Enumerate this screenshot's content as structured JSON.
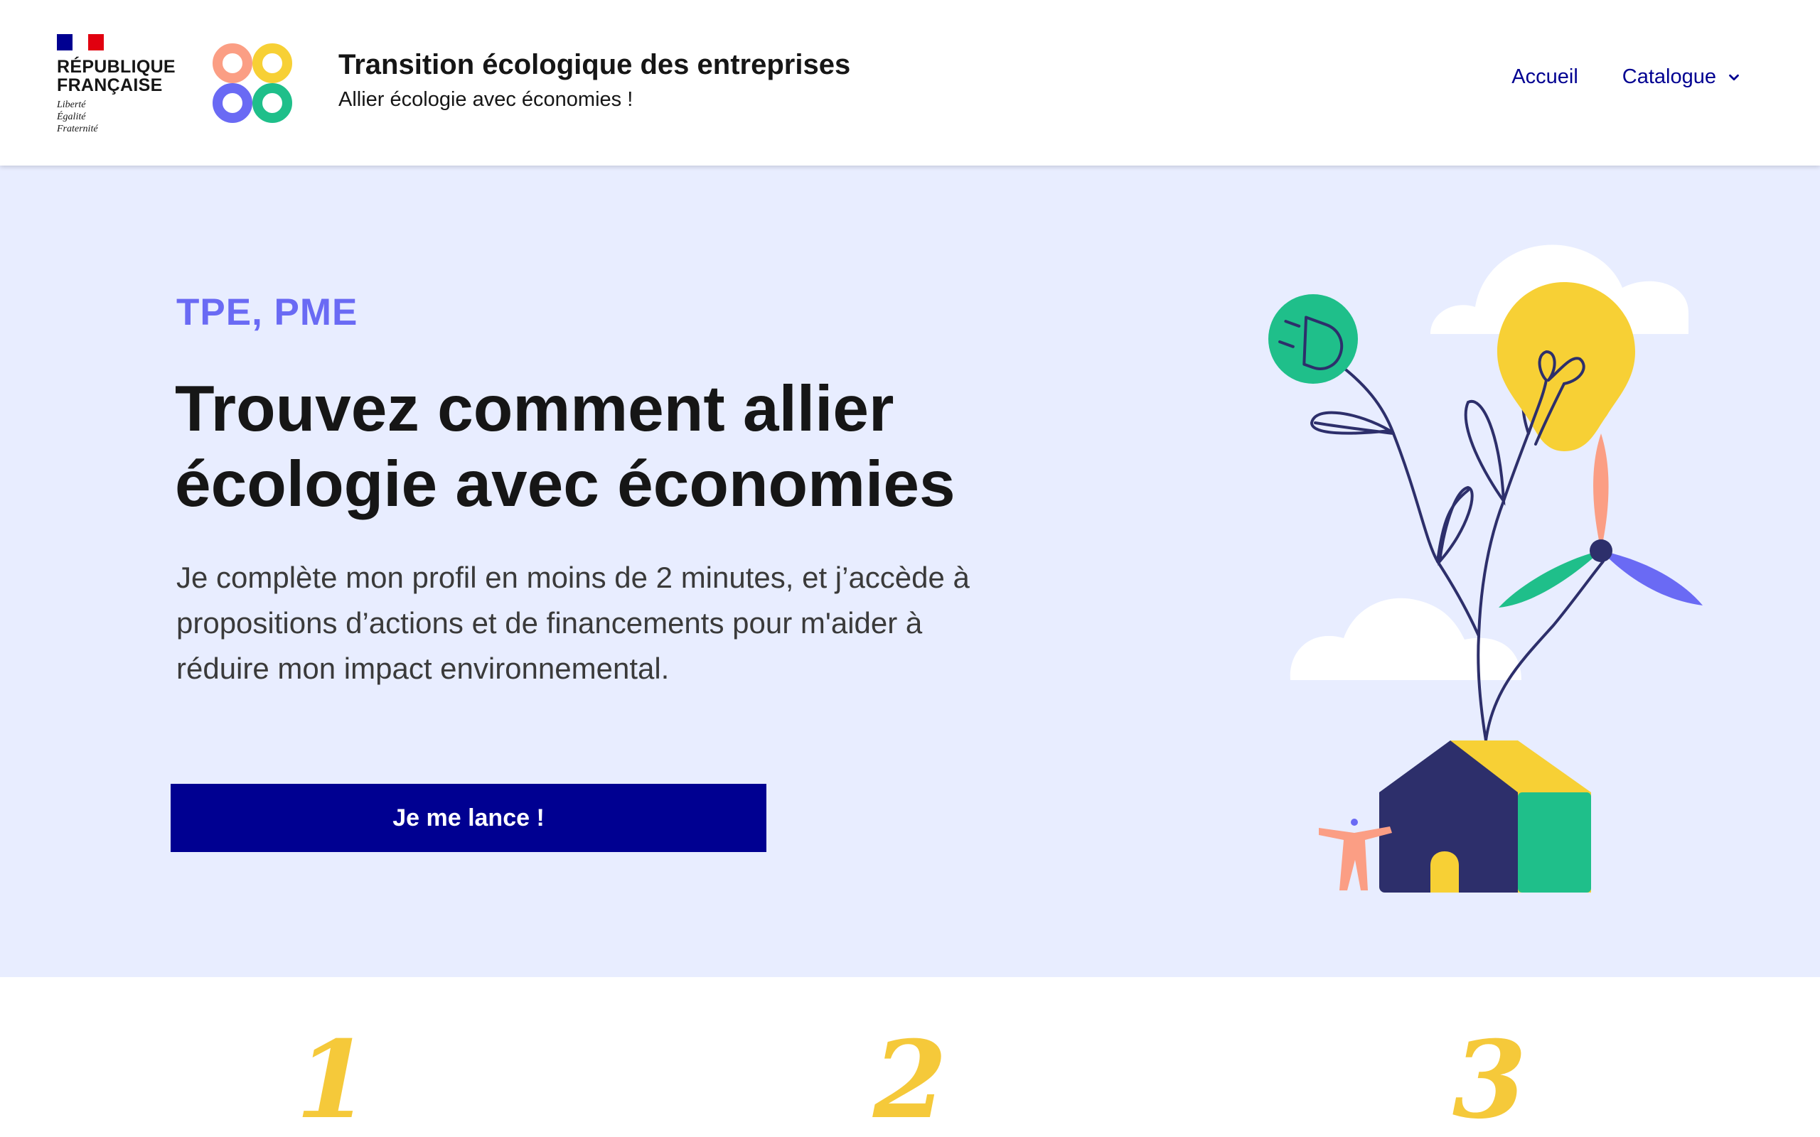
{
  "header": {
    "republic_name_line1": "RÉPUBLIQUE",
    "republic_name_line2": "FRANÇAISE",
    "motto_1": "Liberté",
    "motto_2": "Égalité",
    "motto_3": "Fraternité",
    "service_title": "Transition écologique des entreprises",
    "service_tagline": "Allier écologie avec économies !",
    "nav": {
      "home": "Accueil",
      "catalogue": "Catalogue"
    }
  },
  "hero": {
    "eyebrow": "TPE, PME",
    "title_line1": "Trouvez comment allier",
    "title_line2": "écologie avec économies",
    "text_line1": "Je complète mon profil en moins de 2 minutes, et j’accède à",
    "text_line2": "propositions d’actions et de financements pour m'aider à",
    "text_line3": "réduire mon impact environnemental.",
    "cta_label": "Je me lance !"
  },
  "steps": [
    "1",
    "2",
    "3"
  ],
  "colors": {
    "brand_blue": "#000091",
    "hero_bg": "#e8edff",
    "accent_purple": "#6a6af4",
    "yellow": "#f7d035",
    "green": "#1fbf8a",
    "navy": "#2d2f6b",
    "salmon": "#fb9e84"
  },
  "icons": [
    "chevron-down-icon",
    "logo-88-icon",
    "illustration-plant-house"
  ]
}
